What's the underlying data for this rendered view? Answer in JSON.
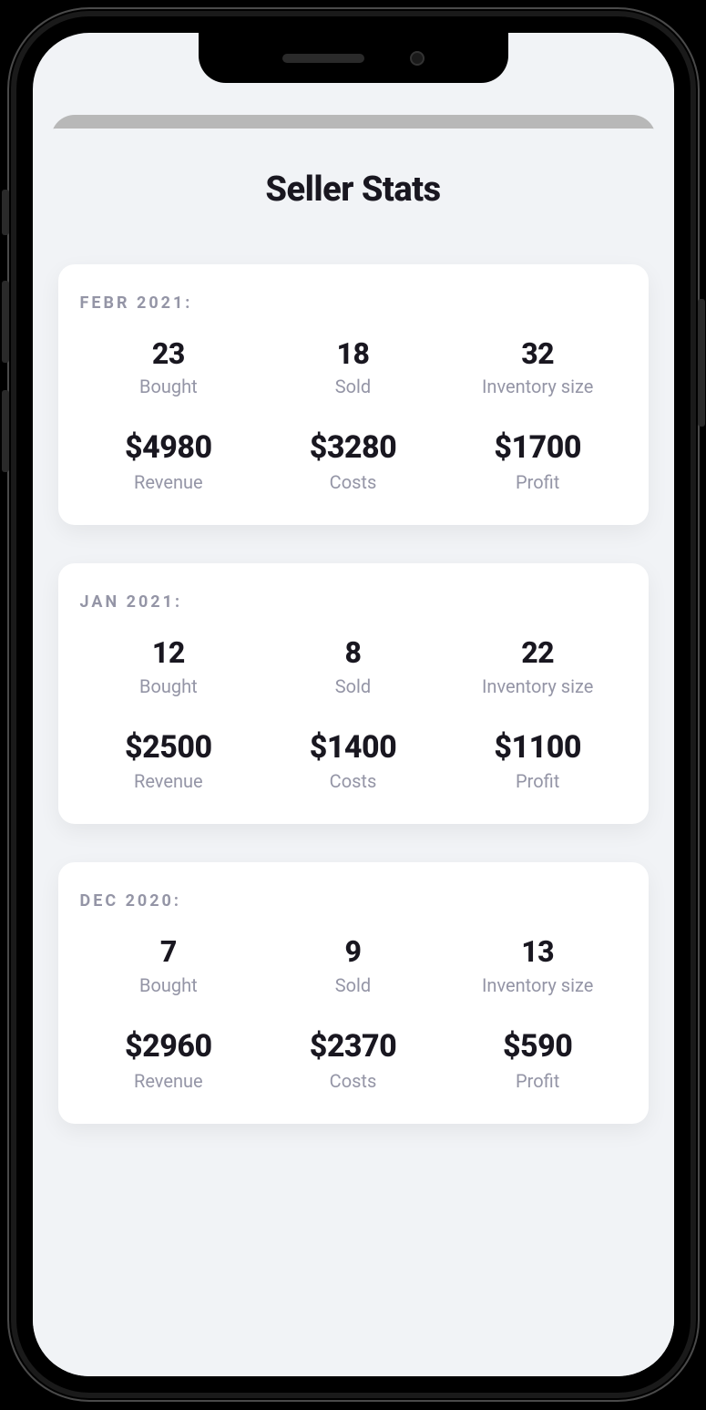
{
  "page": {
    "title": "Seller Stats"
  },
  "labels": {
    "bought": "Bought",
    "sold": "Sold",
    "inventory": "Inventory size",
    "revenue": "Revenue",
    "costs": "Costs",
    "profit": "Profit"
  },
  "periods": [
    {
      "period_label": "FEBR 2021:",
      "bought": "23",
      "sold": "18",
      "inventory": "32",
      "revenue": "$4980",
      "costs": "$3280",
      "profit": "$1700"
    },
    {
      "period_label": "JAN 2021:",
      "bought": "12",
      "sold": "8",
      "inventory": "22",
      "revenue": "$2500",
      "costs": "$1400",
      "profit": "$1100"
    },
    {
      "period_label": "DEC 2020:",
      "bought": "7",
      "sold": "9",
      "inventory": "13",
      "revenue": "$2960",
      "costs": "$2370",
      "profit": "$590"
    }
  ]
}
